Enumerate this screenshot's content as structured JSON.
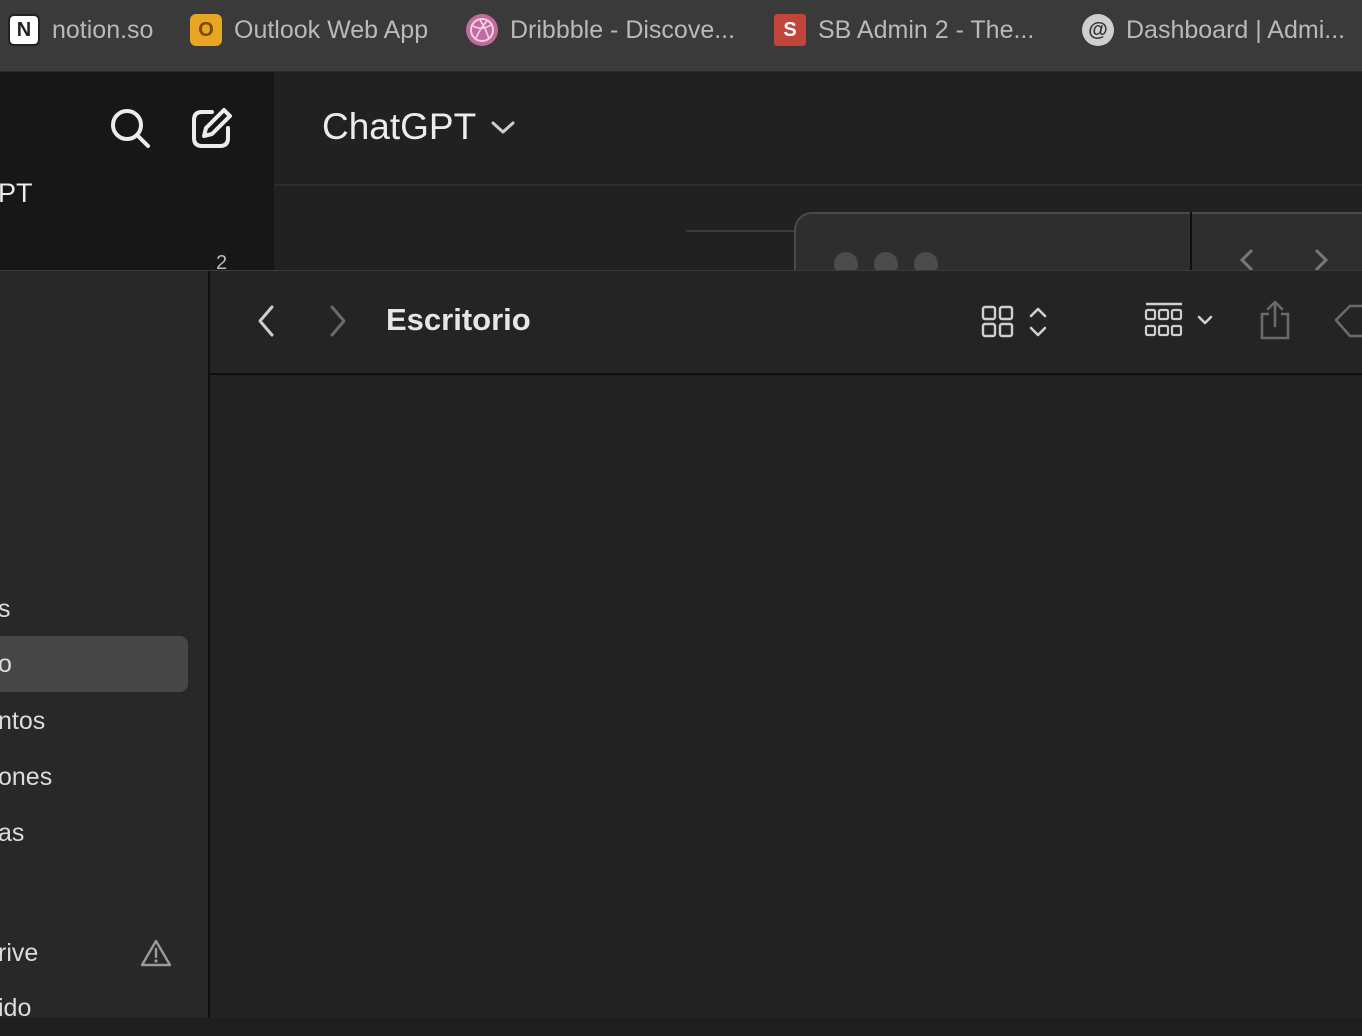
{
  "bookmarks": [
    {
      "label": "notion.so",
      "icon": "notion-icon",
      "color": "#ffffff"
    },
    {
      "label": "Outlook Web App",
      "icon": "outlook-icon",
      "color": "#e8a623"
    },
    {
      "label": "Dribbble - Discove...",
      "icon": "dribbble-icon",
      "color": "#c06aa0"
    },
    {
      "label": "SB Admin 2 - The...",
      "icon": "sb-admin-icon",
      "color": "#c2453c"
    },
    {
      "label": "Dashboard | Admi...",
      "icon": "at-icon",
      "color": "#cfcfcf"
    }
  ],
  "chatgpt": {
    "title": "ChatGPT",
    "sidebar_partial_label": "PT",
    "badge": "2"
  },
  "finder": {
    "title": "Escritorio",
    "sidebar": {
      "items": [
        {
          "label": "s",
          "selected": false
        },
        {
          "label": "o",
          "selected": true
        },
        {
          "label": "ntos",
          "selected": false
        },
        {
          "label": "ones",
          "selected": false
        },
        {
          "label": "as",
          "selected": false
        }
      ],
      "cloud_items": [
        {
          "label": "rive",
          "warning": true
        },
        {
          "label": "ido",
          "warning": false
        }
      ]
    }
  },
  "colors": {
    "accent_selected": "#464646",
    "window_bg": "#1e1e1e"
  }
}
